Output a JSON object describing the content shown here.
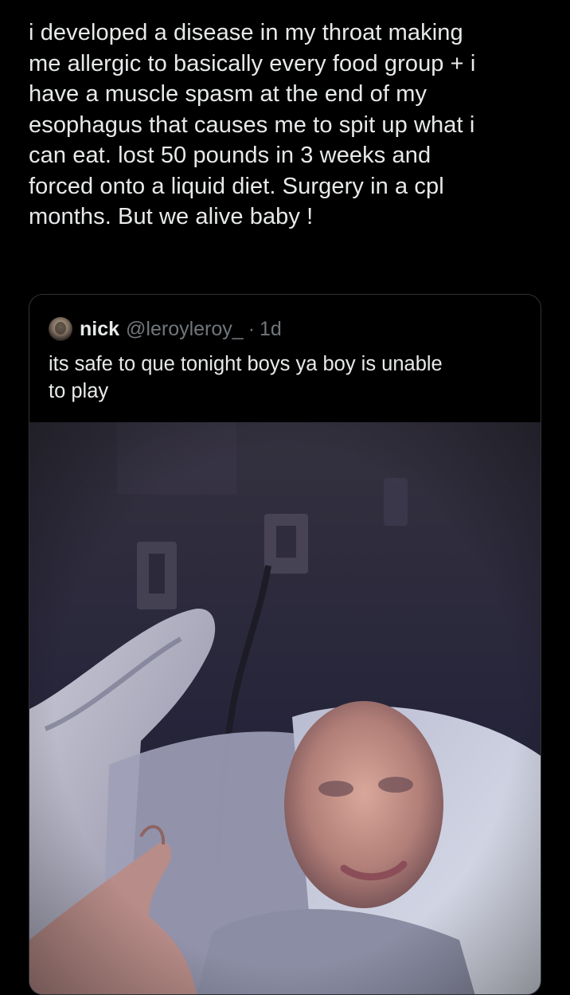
{
  "tweet": {
    "text": "i developed a disease in my throat making\nme allergic to basically every food group + i\nhave a muscle spasm at the end of my\nesophagus that causes me to spit up what i\ncan eat. lost 50 pounds in 3 weeks and\nforced onto a liquid diet. Surgery in a cpl\nmonths. But we alive baby !"
  },
  "quoted_tweet": {
    "author_name": "nick",
    "author_handle": "@leroyleroy_",
    "separator": "·",
    "time": "1d",
    "text": "its safe to que tonight boys ya boy is unable\nto play",
    "avatar_icon": "user-avatar-icon",
    "media_description_icon": "photo-media"
  },
  "colors": {
    "background": "#000000",
    "text_primary": "#e7e9ea",
    "text_secondary": "#71767b",
    "card_border": "#2f3336"
  }
}
